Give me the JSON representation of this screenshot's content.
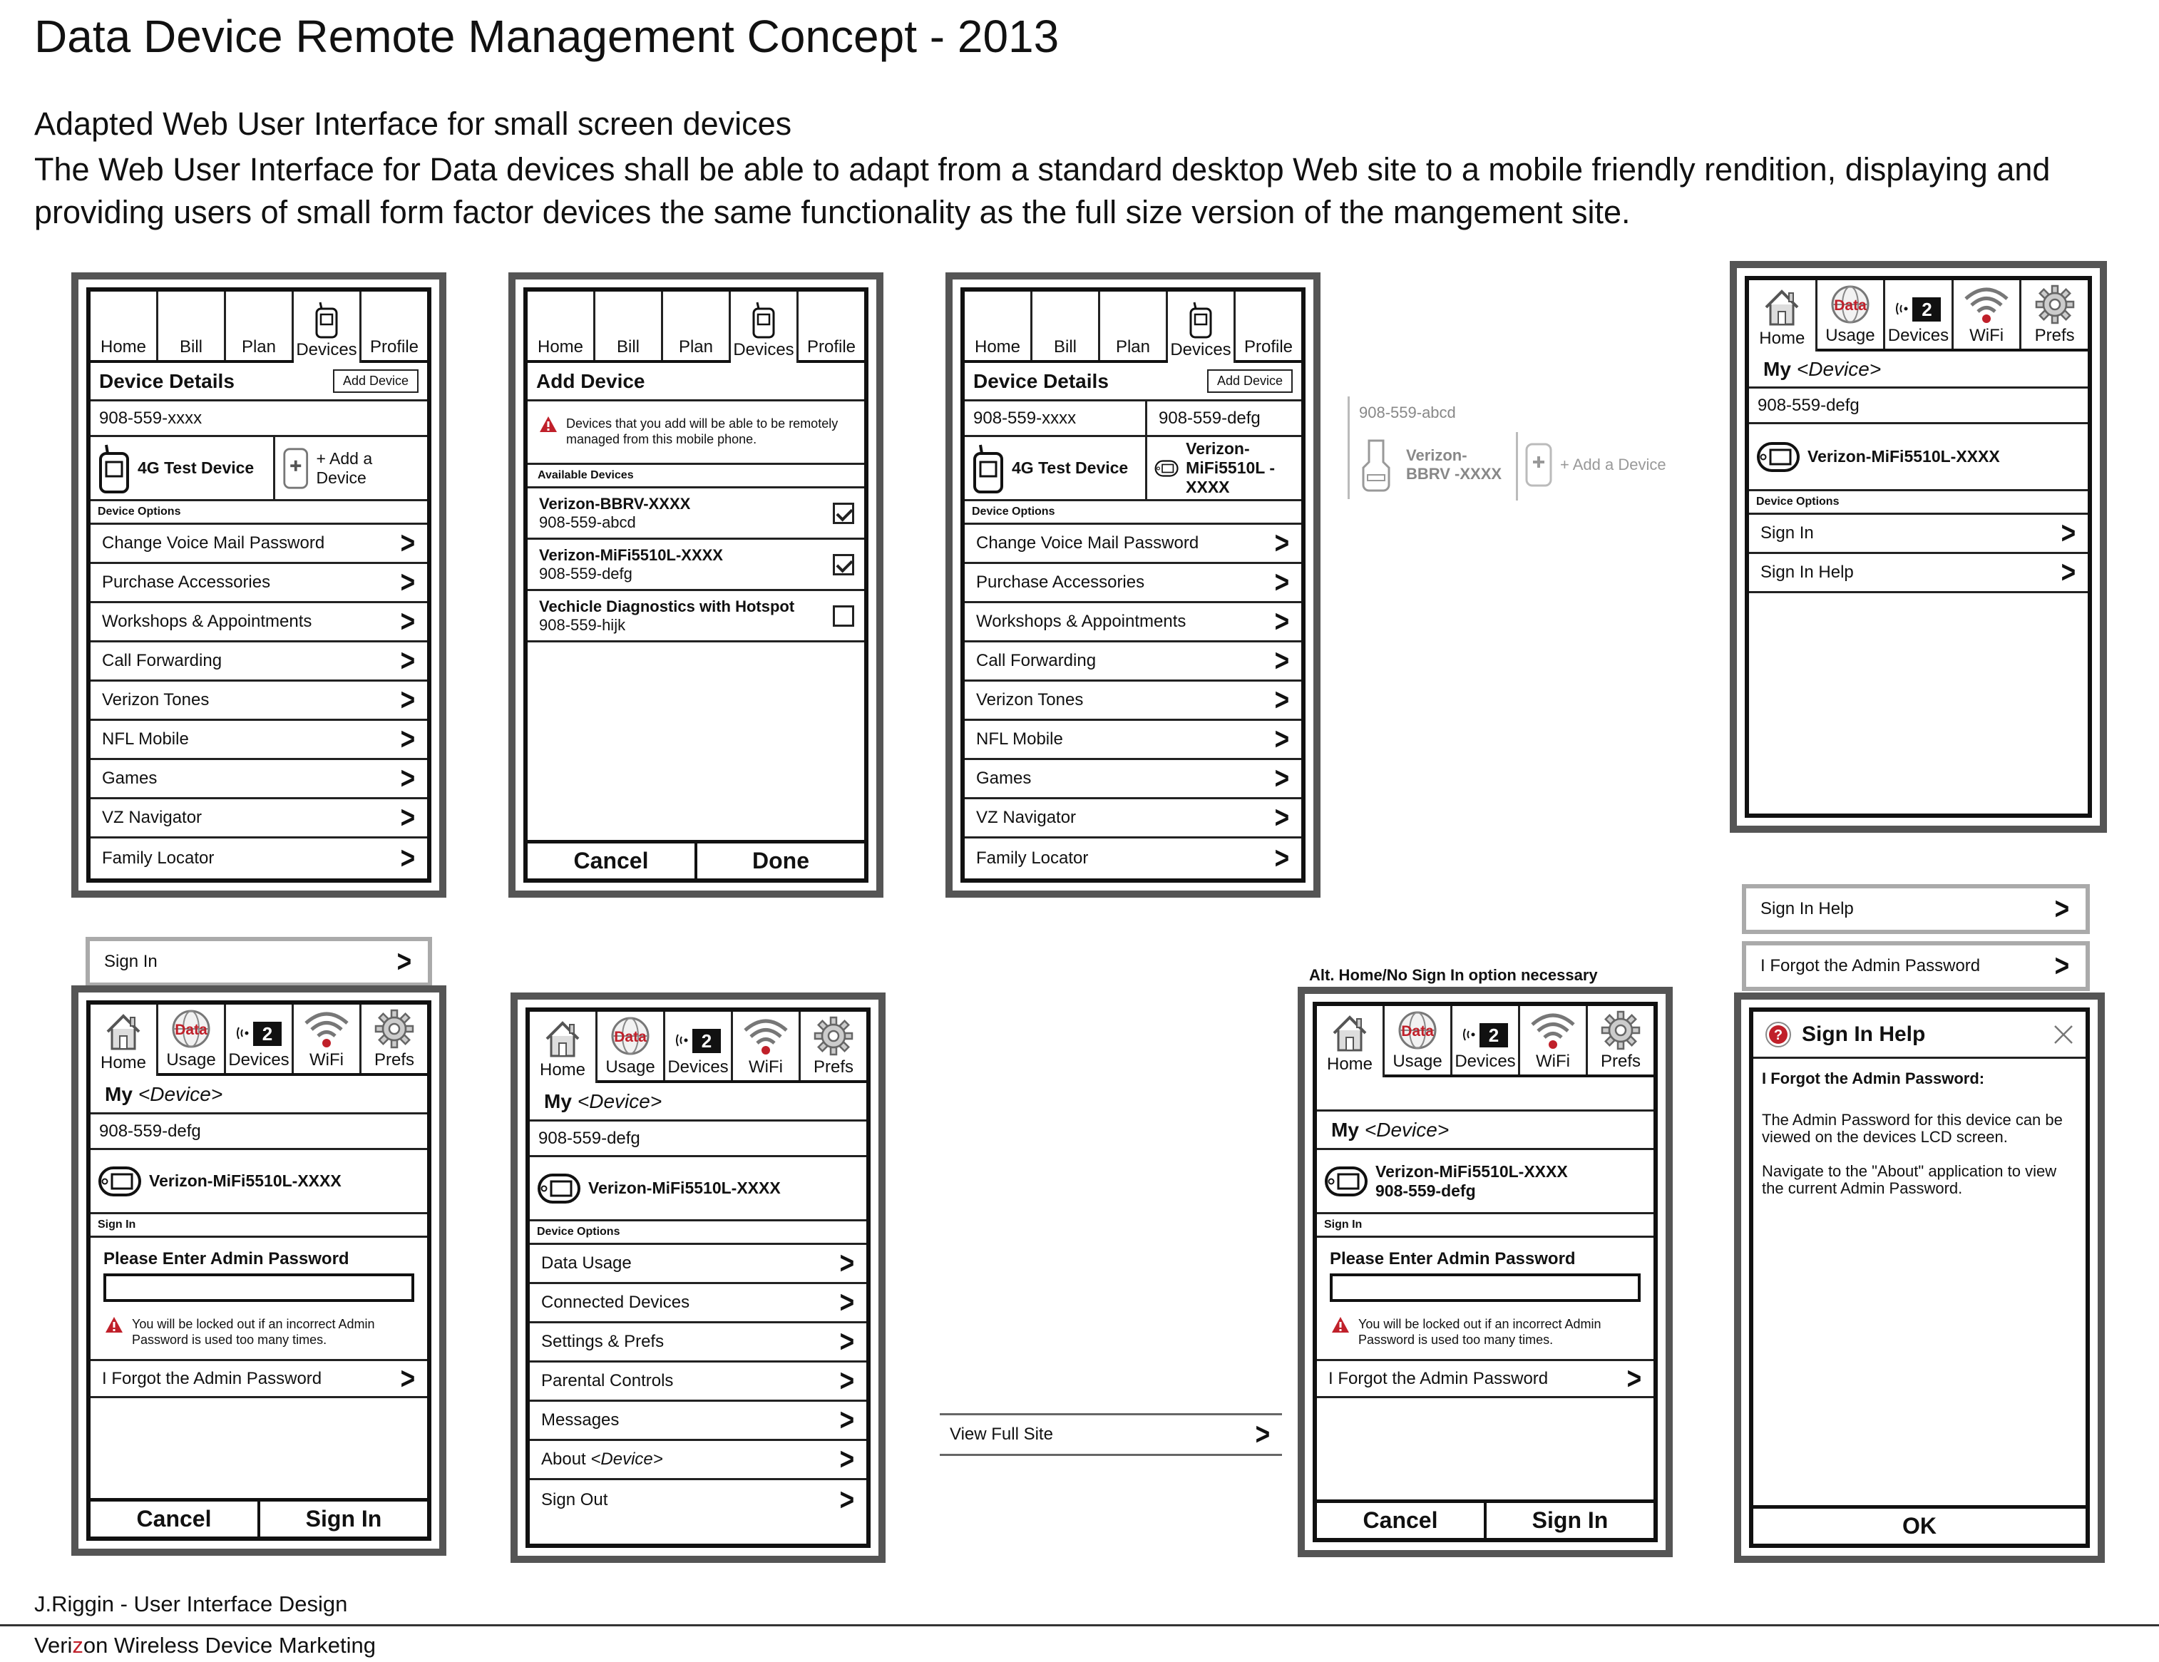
{
  "header": {
    "title": "Data Device Remote Management Concept - 2013",
    "subtitle": "Adapted Web User Interface for small screen devices",
    "description": "The Web User Interface for Data devices shall be able to adapt from a standard desktop Web site to a mobile friendly rendition, displaying and providing users of small form factor devices the same functionality as the full size version of the mangement site."
  },
  "tabs_main": [
    "Home",
    "Bill",
    "Plan",
    "Devices",
    "Profile"
  ],
  "tabs_icon": [
    "Home",
    "Usage",
    "Devices",
    "WiFi",
    "Prefs"
  ],
  "icon_data_word": "Data",
  "devices_count": "2",
  "device_details": {
    "title": "Device Details",
    "add_button": "Add Device",
    "number": "908-559-xxxx",
    "device_name": "4G Test Device",
    "add_device_link": "+ Add a Device",
    "section": "Device Options",
    "options": [
      "Change Voice Mail Password",
      "Purchase Accessories",
      "Workshops & Appointments",
      "Call Forwarding",
      "Verizon Tones",
      "NFL Mobile",
      "Games",
      "VZ Navigator",
      "Family Locator"
    ]
  },
  "add_device": {
    "title": "Add Device",
    "alert": "Devices that you add will be able to be remotely managed from this mobile phone.",
    "section": "Available Devices",
    "devices": [
      {
        "name": "Verizon-BBRV-XXXX",
        "number": "908-559-abcd",
        "checked": true
      },
      {
        "name": "Verizon-MiFi5510L-XXXX",
        "number": "908-559-defg",
        "checked": true
      },
      {
        "name": "Vechicle Diagnostics with Hotspot",
        "number": "908-559-hijk",
        "checked": false
      }
    ],
    "cancel": "Cancel",
    "done": "Done"
  },
  "device_details_multi": {
    "title": "Device Details",
    "add_button": "Add Device",
    "number1": "908-559-xxxx",
    "number2": "908-559-defg",
    "number3": "908-559-abcd",
    "device1": "4G Test Device",
    "device2": "Verizon-MiFi5510L -XXXX",
    "device3": "Verizon-BBRV -XXXX",
    "add_device_link": "+ Add a Device"
  },
  "mydevice": {
    "my": "My",
    "device_tag": "<Device>",
    "number": "908-559-defg",
    "device_name": "Verizon-MiFi5510L-XXXX",
    "section_options": "Device Options",
    "sign_in": "Sign In",
    "sign_in_help": "Sign In Help"
  },
  "loose": {
    "sign_in": "Sign In",
    "sign_in_help": "Sign In Help",
    "forgot": "I Forgot the Admin Password",
    "view_full_site": "View Full Site",
    "alt_note": "Alt. Home/No Sign In option necessary"
  },
  "signin": {
    "section": "Sign In",
    "label": "Please Enter Admin Password",
    "alert": "You will be locked out if an incorrect Admin Password is used too many times.",
    "forgot": "I Forgot the Admin Password",
    "cancel": "Cancel",
    "submit": "Sign In",
    "number_line": "908-559-defg"
  },
  "signed_in_options": [
    "Data Usage",
    "Connected Devices",
    "Settings & Prefs",
    "Parental Controls",
    "Messages",
    "About",
    "Sign Out"
  ],
  "dialog": {
    "title": "Sign In Help",
    "heading": "I Forgot the Admin Password:",
    "p1": "The Admin Password for this device can be viewed on the devices LCD screen.",
    "p2": "Navigate to the \"About\" application to view the current Admin Password.",
    "ok": "OK"
  },
  "footer": {
    "designer": "J.Riggin - User Interface Design",
    "dept_pre": "Veri",
    "dept_z": "z",
    "dept_post": "on Wireless Device Marketing"
  },
  "colors": {
    "alert_red": "#c0202a",
    "frame_gray": "#555555"
  }
}
